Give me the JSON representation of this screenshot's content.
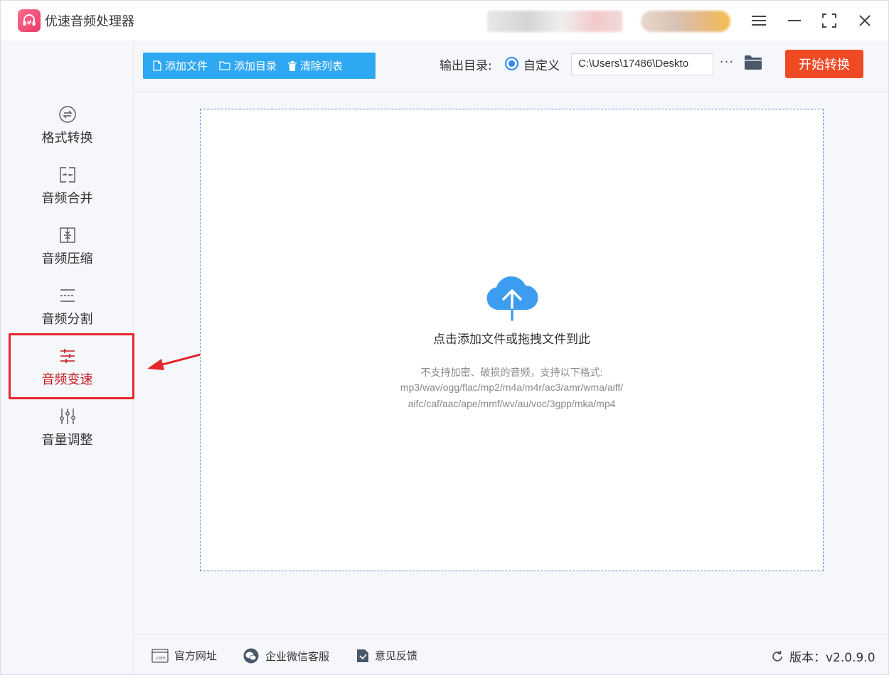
{
  "app": {
    "title": "优速音频处理器"
  },
  "window_controls": {
    "menu": "menu-icon",
    "minimize": "minimize-icon",
    "maximize": "maximize-icon",
    "close": "close-icon"
  },
  "sidebar": {
    "items": [
      {
        "label": "格式转换",
        "icon": "format-convert-icon"
      },
      {
        "label": "音频合并",
        "icon": "merge-icon"
      },
      {
        "label": "音频压缩",
        "icon": "compress-icon"
      },
      {
        "label": "音频分割",
        "icon": "split-icon"
      },
      {
        "label": "音频变速",
        "icon": "speed-sliders-icon",
        "active": true
      },
      {
        "label": "音量调整",
        "icon": "volume-sliders-icon"
      }
    ]
  },
  "toolbar": {
    "add_file": "添加文件",
    "add_folder": "添加目录",
    "clear_list": "清除列表",
    "output_label": "输出目录:",
    "custom_option": "自定义",
    "output_path": "C:\\Users\\17486\\Deskto",
    "more": "···",
    "start": "开始转换"
  },
  "dropzone": {
    "title": "点击添加文件或拖拽文件到此",
    "hint_line1": "不支持加密、破损的音频，支持以下格式:",
    "hint_line2": "mp3/wav/ogg/flac/mp2/m4a/m4r/ac3/amr/wma/aiff/",
    "hint_line3": "aifc/caf/aac/ape/mmf/wv/au/voc/3gpp/mka/mp4"
  },
  "footer": {
    "website": "官方网址",
    "wechat": "企业微信客服",
    "feedback": "意见反馈",
    "version": "版本：v2.0.9.0"
  },
  "colors": {
    "accent_blue": "#2fa8f2",
    "start_orange": "#f04a24",
    "highlight_red": "#e6262d",
    "active_text": "#c4161c",
    "cloud_blue": "#3c9df0"
  }
}
